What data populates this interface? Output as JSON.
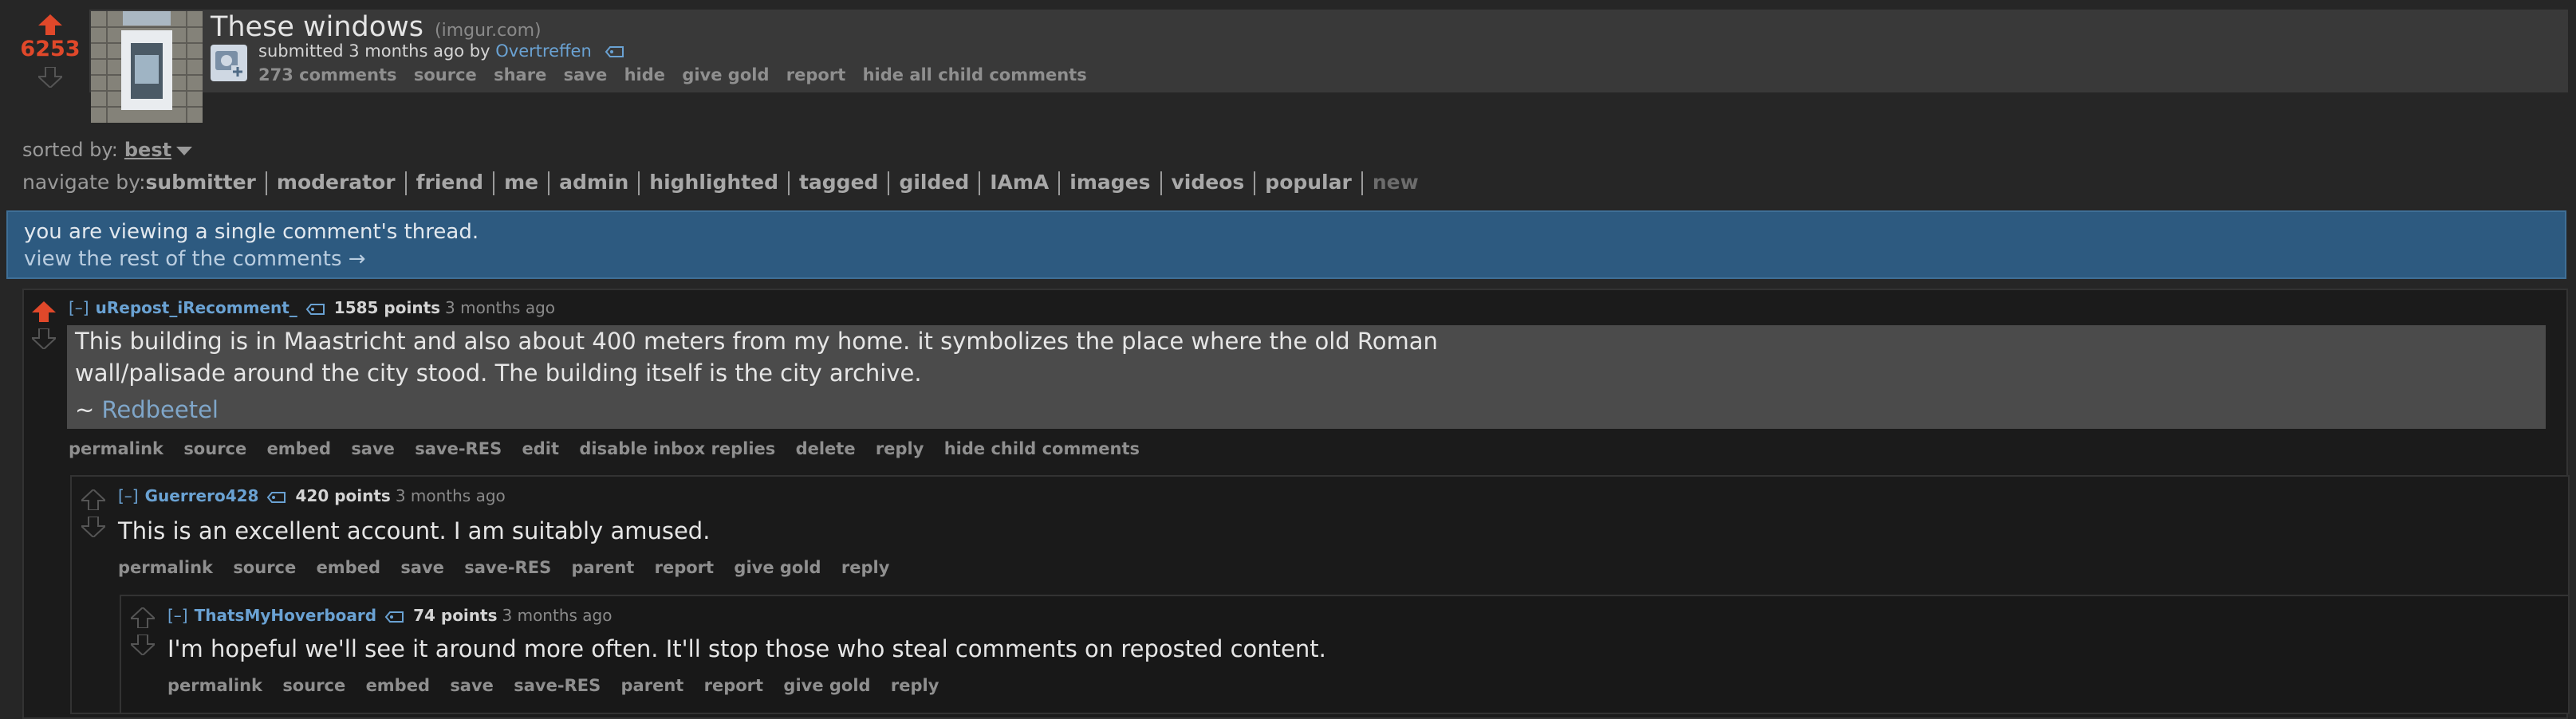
{
  "post": {
    "score": "6253",
    "title": "These windows",
    "domain": "(imgur.com)",
    "tagline_prefix": "submitted 3 months ago by",
    "author": "Overtreffen",
    "buttons": [
      "273 comments",
      "source",
      "share",
      "save",
      "hide",
      "give gold",
      "report",
      "hide all child comments"
    ]
  },
  "sort": {
    "label": "sorted by:",
    "value": "best"
  },
  "nav": {
    "label": "navigate by:",
    "items": [
      "submitter",
      "moderator",
      "friend",
      "me",
      "admin",
      "highlighted",
      "tagged",
      "gilded",
      "IAmA",
      "images",
      "videos",
      "popular"
    ],
    "disabled_item": "new"
  },
  "info": {
    "line1": "you are viewing a single comment's thread.",
    "line2": "view the rest of the comments →"
  },
  "comments": [
    {
      "collapse": "[–]",
      "author": "uRepost_iRecomment_",
      "points": "1585 points",
      "time": "3 months ago",
      "body_lines": [
        "This building is in Maastricht and also about 400 meters from my home. it symbolizes the place where the old Roman",
        "wall/palisade around the city stood. The building itself is the city archive."
      ],
      "sig_prefix": "~",
      "sig_name": "Redbeetel",
      "buttons": [
        "permalink",
        "source",
        "embed",
        "save",
        "save-RES",
        "edit",
        "disable inbox replies",
        "delete",
        "reply",
        "hide child comments"
      ]
    },
    {
      "collapse": "[–]",
      "author": "Guerrero428",
      "points": "420 points",
      "time": "3 months ago",
      "body": "This is an excellent account. I am suitably amused.",
      "buttons": [
        "permalink",
        "source",
        "embed",
        "save",
        "save-RES",
        "parent",
        "report",
        "give gold",
        "reply"
      ]
    },
    {
      "collapse": "[–]",
      "author": "ThatsMyHoverboard",
      "points": "74 points",
      "time": "3 months ago",
      "body": "I'm hopeful we'll see it around more often. It'll stop those who steal comments on reposted content.",
      "buttons": [
        "permalink",
        "source",
        "embed",
        "save",
        "save-RES",
        "parent",
        "report",
        "give gold",
        "reply"
      ]
    }
  ],
  "colors": {
    "upvote": "#e0482a",
    "link": "#6aa2d3",
    "infobar": "#2d5a80"
  }
}
